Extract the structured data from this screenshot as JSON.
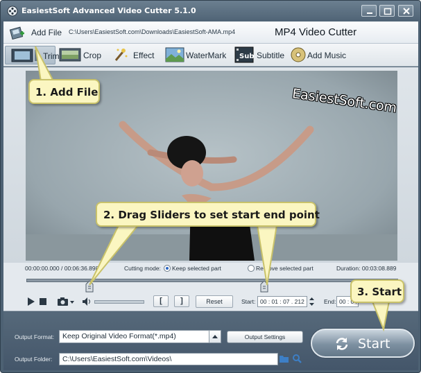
{
  "window": {
    "title": "EasiestSoft Advanced Video Cutter 5.1.0"
  },
  "filebar": {
    "add_file_label": "Add File",
    "file_path": "C:\\Users\\EasiestSoft.com\\Downloads\\EasiestSoft-AMA.mp4",
    "cutter_title": "MP4 Video Cutter"
  },
  "tabs": [
    {
      "label": "Trim",
      "icon": "film-trim-icon",
      "selected": true
    },
    {
      "label": "Crop",
      "icon": "crop-icon"
    },
    {
      "label": "Effect",
      "icon": "effect-wand-icon"
    },
    {
      "label": "WaterMark",
      "icon": "watermark-icon"
    },
    {
      "label": "Subtitle",
      "icon": "subtitle-icon"
    },
    {
      "label": "Add Music",
      "icon": "music-disc-icon"
    }
  ],
  "preview": {
    "watermark": "EasiestSoft.com"
  },
  "info": {
    "position": "00:00:00.000 / 00:06:36.898",
    "cutting_mode_label": "Cutting mode:",
    "keep_label": "Keep selected part",
    "remove_label": "Remove selected part",
    "mode_selected": "keep",
    "duration": "Duration: 00:03:08.889"
  },
  "slider": {
    "start_fraction": 0.17,
    "end_fraction": 0.64
  },
  "controls": {
    "set_start_label": "[",
    "set_end_label": "]",
    "reset_label": "Reset",
    "start_label": "Start:",
    "start_value": "00 : 01 : 07 . 212",
    "end_label": "End:",
    "end_value": "00 : 04"
  },
  "output": {
    "format_label": "Output Format:",
    "format_value": "Keep Original Video Format(*.mp4)",
    "settings_label": "Output Settings",
    "folder_label": "Output Folder:",
    "folder_value": "C:\\Users\\EasiestSoft.com\\Videos\\",
    "start_label": "Start"
  },
  "callouts": {
    "step1": "1. Add File",
    "step2": "2. Drag Sliders to set start end point",
    "step3": "3. Start"
  },
  "colors": {
    "callout_bg": "#fbf6c1",
    "callout_border": "#c9c26a",
    "frame": "#4d6173"
  }
}
